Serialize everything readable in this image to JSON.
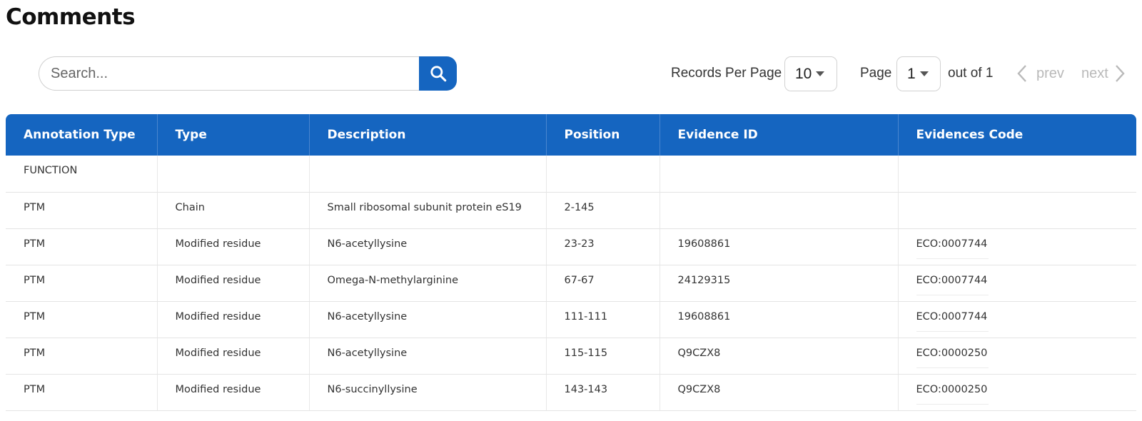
{
  "page": {
    "title": "Comments"
  },
  "search": {
    "placeholder": "Search..."
  },
  "pagination": {
    "records_per_page_label": "Records Per Page",
    "records_per_page_value": "10",
    "page_label": "Page",
    "page_value": "1",
    "out_of_label": "out of 1",
    "prev_label": "prev",
    "next_label": "next"
  },
  "table": {
    "columns": [
      "Annotation Type",
      "Type",
      "Description",
      "Position",
      "Evidence ID",
      "Evidences Code"
    ],
    "rows": [
      [
        "FUNCTION",
        "",
        "",
        "",
        "",
        ""
      ],
      [
        "PTM",
        "Chain",
        "Small ribosomal subunit protein eS19",
        "2-145",
        "",
        ""
      ],
      [
        "PTM",
        "Modified residue",
        "N6-acetyllysine",
        "23-23",
        "19608861",
        "ECO:0007744"
      ],
      [
        "PTM",
        "Modified residue",
        "Omega-N-methylarginine",
        "67-67",
        "24129315",
        "ECO:0007744"
      ],
      [
        "PTM",
        "Modified residue",
        "N6-acetyllysine",
        "111-111",
        "19608861",
        "ECO:0007744"
      ],
      [
        "PTM",
        "Modified residue",
        "N6-acetyllysine",
        "115-115",
        "Q9CZX8",
        "ECO:0000250"
      ],
      [
        "PTM",
        "Modified residue",
        "N6-succinyllysine",
        "143-143",
        "Q9CZX8",
        "ECO:0000250"
      ]
    ]
  },
  "colors": {
    "accent": "#1565c0",
    "header_text": "#ffffff",
    "disabled": "#b9b9b9"
  },
  "icons": {
    "search": "search-icon",
    "prev": "chevron-left-icon",
    "next": "chevron-right-icon",
    "dropdown": "caret-down-icon"
  }
}
